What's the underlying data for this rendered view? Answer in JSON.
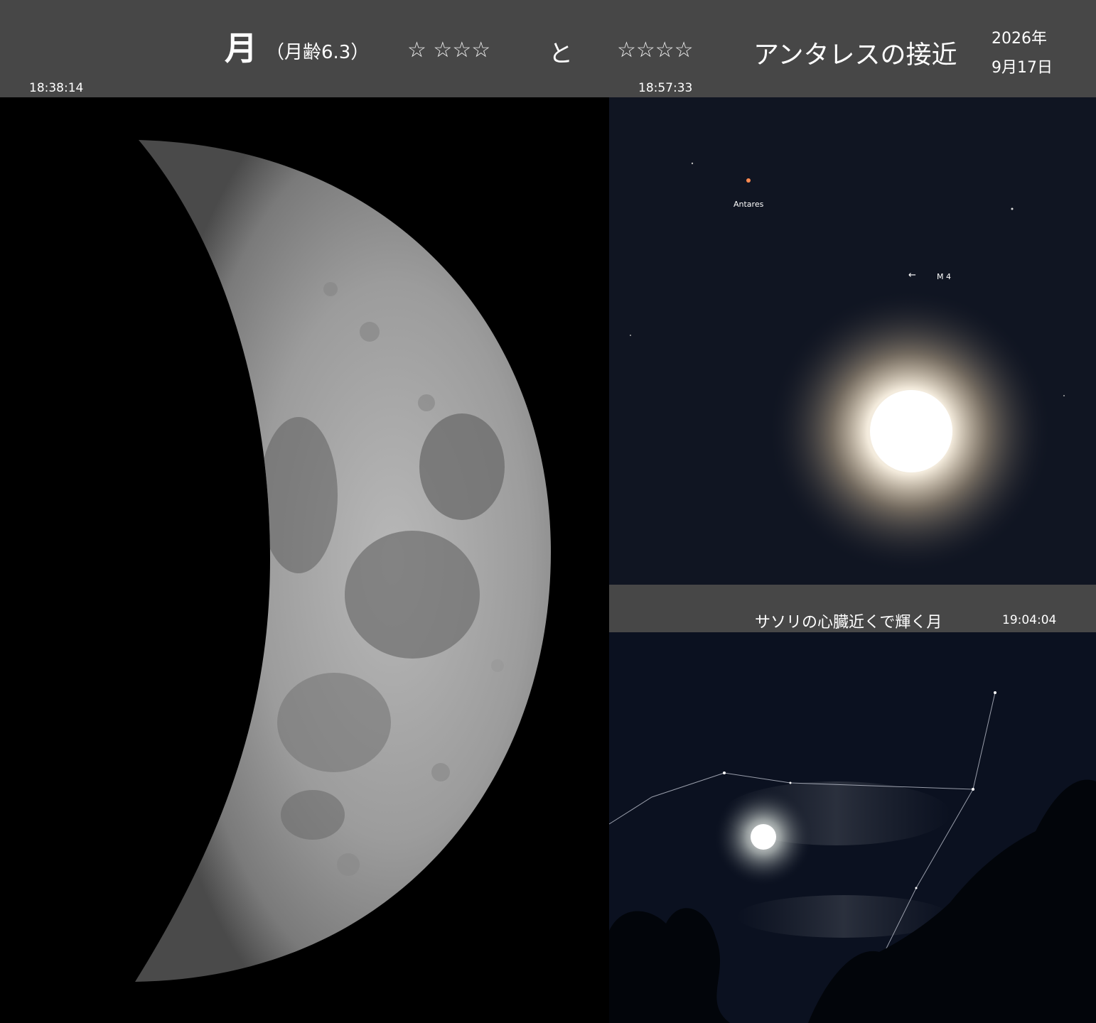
{
  "header": {
    "moon": "月",
    "moon_age": "（月齢6.3）",
    "rating_moon": "☆ ☆☆☆",
    "conjunction": "と",
    "rating_antares": "☆☆☆☆",
    "event": "アンタレスの接近",
    "year": "2026年",
    "day": "9月17日"
  },
  "times": {
    "left_photo": "18:38:14",
    "top_right_photo": "18:57:33",
    "bottom_right_photo": "19:04:04"
  },
  "top_right": {
    "star_label": "Antares",
    "cluster_label": "M 4",
    "arrow_glyph": "←"
  },
  "bottom_right": {
    "caption": "サソリの心臓近くで輝く月"
  },
  "colors": {
    "header_bg": "#474747",
    "sky_top": "#101522",
    "sky_bottom": "#0b1120",
    "antares": "#ff8a50"
  }
}
